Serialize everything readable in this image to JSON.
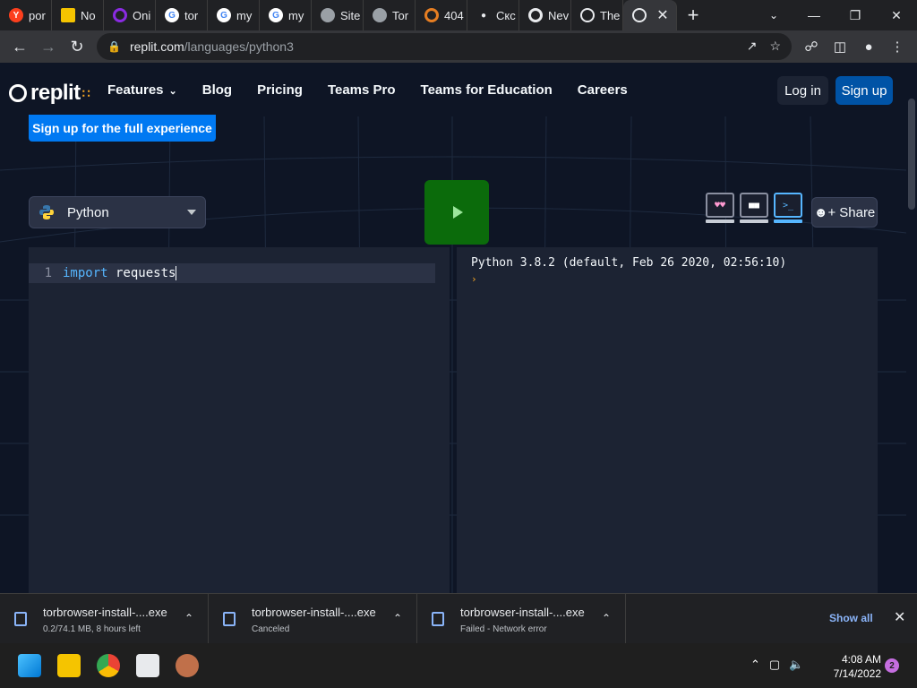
{
  "tabs": [
    {
      "label": "por",
      "icon": "yandex-icon",
      "color": "#fc3f1d"
    },
    {
      "label": "No",
      "icon": "flag-icon",
      "color": "#f5c400"
    },
    {
      "label": "Oni",
      "icon": "opera-icon",
      "color": "#8a2be2"
    },
    {
      "label": "tor",
      "icon": "google-icon",
      "color": "#ffffff"
    },
    {
      "label": "my",
      "icon": "google-icon",
      "color": "#ffffff"
    },
    {
      "label": "my",
      "icon": "google-icon",
      "color": "#ffffff"
    },
    {
      "label": "Site",
      "icon": "globe-icon",
      "color": "#9aa0a6"
    },
    {
      "label": "Tor",
      "icon": "globe-icon",
      "color": "#9aa0a6"
    },
    {
      "label": "404",
      "icon": "target-icon",
      "color": "#e67e22"
    },
    {
      "label": "Скс",
      "icon": "apple-icon",
      "color": "#e8eaed"
    },
    {
      "label": "Nev",
      "icon": "chrome-icon",
      "color": "#e8eaed"
    },
    {
      "label": "The",
      "icon": "replit-icon",
      "color": "#e8eaed"
    }
  ],
  "active_tab_icon": "replit-icon",
  "url": {
    "host": "replit.com",
    "path": "/languages/python3"
  },
  "site": {
    "logo_text": "replit",
    "nav": [
      {
        "label": "Features",
        "has_dropdown": true
      },
      {
        "label": "Blog"
      },
      {
        "label": "Pricing"
      },
      {
        "label": "Teams Pro"
      },
      {
        "label": "Teams for Education"
      },
      {
        "label": "Careers"
      }
    ],
    "login_label": "Log in",
    "signup_label": "Sign up",
    "full_experience_label": "Sign up for the full experience",
    "language_selected": "Python",
    "share_label": "Share",
    "editor": {
      "line_number": "1",
      "keyword": "import",
      "rest": " requests"
    },
    "console": {
      "version_line": "Python 3.8.2 (default, Feb 26 2020, 02:56:10)",
      "prompt": "›"
    }
  },
  "downloads": [
    {
      "name": "torbrowser-install-....exe",
      "status": "0.2/74.1 MB, 8 hours left"
    },
    {
      "name": "torbrowser-install-....exe",
      "status": "Canceled"
    },
    {
      "name": "torbrowser-install-....exe",
      "status": "Failed - Network error"
    }
  ],
  "downloads_show_all": "Show all",
  "clock": {
    "time": "4:08 AM",
    "date": "7/14/2022"
  },
  "notification_count": "2",
  "colors": {
    "accent": "#0079f2",
    "run": "#0b6b0b",
    "bg": "#0e1525",
    "panel": "#1c2333"
  }
}
